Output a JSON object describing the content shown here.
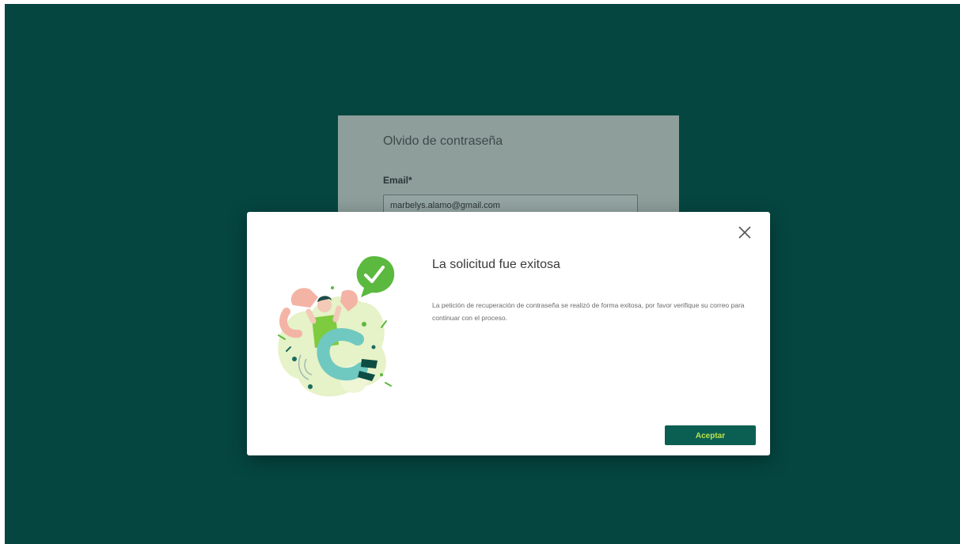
{
  "background_form": {
    "title": "Olvido de contraseña",
    "email_label": "Email*",
    "email_value": "marbelys.alamo@gmail.com"
  },
  "modal": {
    "title": "La solicitud fue exitosa",
    "message": "La petición de recuperación de contraseña se realizó de forma exitosa, por favor verifique su correo para continuar con el proceso.",
    "accept_label": "Aceptar",
    "close_icon": "close-icon",
    "illustration_icons": [
      "success-check-icon",
      "celebrating-person-illustration"
    ]
  },
  "colors": {
    "page_background": "#054641",
    "primary_button": "#0b5f52",
    "button_text": "#b9e34f",
    "success_green": "#5cb93f"
  }
}
